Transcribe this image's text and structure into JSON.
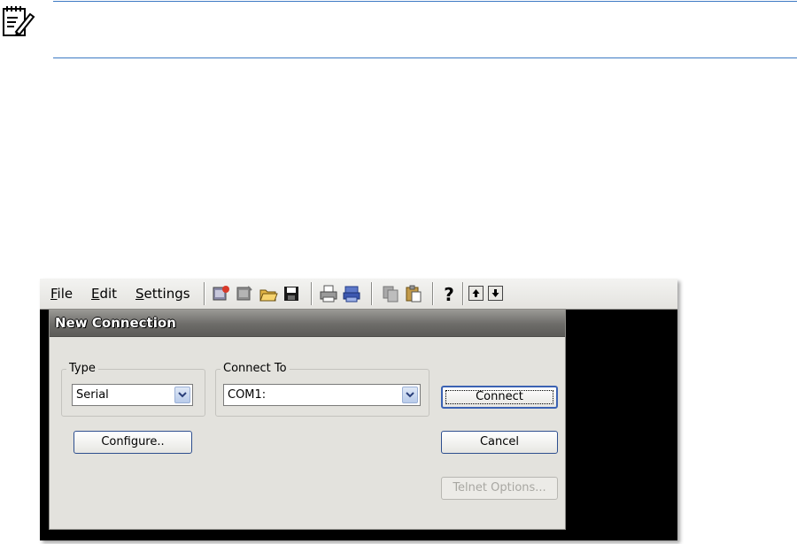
{
  "menubar": {
    "items": [
      "File",
      "Edit",
      "Settings"
    ]
  },
  "toolbar": {
    "icons": [
      "new-connection-icon",
      "disconnect-icon",
      "open-folder-icon",
      "save-icon",
      "print-icon",
      "print-setup-icon",
      "copy-icon",
      "paste-icon",
      "help-icon",
      "scroll-up-icon",
      "scroll-down-icon"
    ]
  },
  "dialog": {
    "title": "New Connection",
    "type_group_label": "Type",
    "type_value": "Serial",
    "connect_group_label": "Connect To",
    "connect_value": "COM1:",
    "configure_label": "Configure..",
    "connect_label": "Connect",
    "cancel_label": "Cancel",
    "telnet_label": "Telnet Options..."
  },
  "colors": {
    "rule": "#3d79c4",
    "dialog_bg": "#e3e2dd",
    "title_bar": "#6d6c69"
  }
}
